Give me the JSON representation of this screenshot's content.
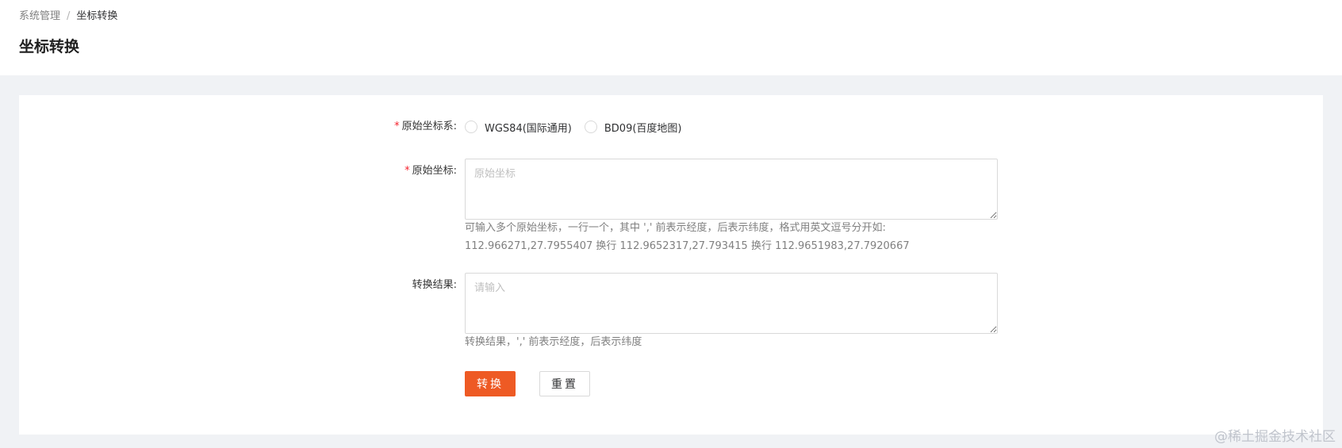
{
  "breadcrumb": {
    "parent": "系统管理",
    "separator": "/",
    "current": "坐标转换"
  },
  "page_title": "坐标转换",
  "form": {
    "source_system": {
      "required_mark": "*",
      "label": "原始坐标系:",
      "options": [
        {
          "label": "WGS84(国际通用)",
          "checked": false
        },
        {
          "label": "BD09(百度地图)",
          "checked": false
        }
      ]
    },
    "source_coords": {
      "required_mark": "*",
      "label": "原始坐标:",
      "value": "",
      "placeholder": "原始坐标",
      "hint_line1": "可输入多个原始坐标，一行一个，其中 ',' 前表示经度，后表示纬度，格式用英文逗号分开如:",
      "hint_line2": "112.966271,27.7955407 换行 112.9652317,27.793415 换行 112.9651983,27.7920667"
    },
    "result": {
      "label": "转换结果:",
      "value": "",
      "placeholder": "请输入",
      "hint": "转换结果，',' 前表示经度，后表示纬度"
    },
    "buttons": {
      "convert": "转换",
      "reset": "重置"
    }
  },
  "watermark": "@稀土掘金技术社区",
  "colors": {
    "primary": "#ee5a24",
    "required": "#f5222d",
    "background": "#f0f2f5"
  }
}
